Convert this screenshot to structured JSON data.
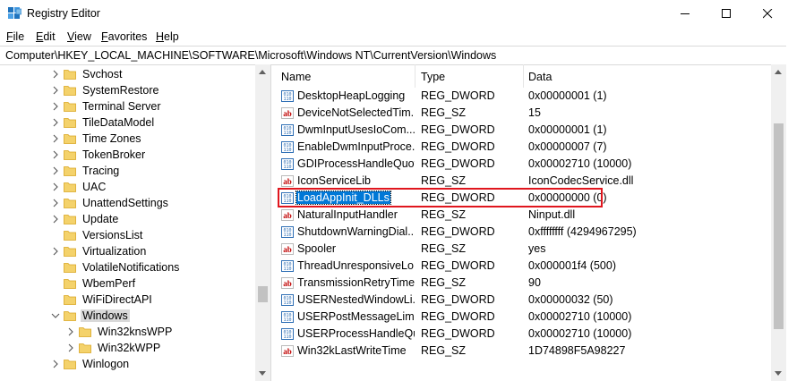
{
  "window": {
    "title": "Registry Editor"
  },
  "menu": [
    "File",
    "Edit",
    "View",
    "Favorites",
    "Help"
  ],
  "address": "Computer\\HKEY_LOCAL_MACHINE\\SOFTWARE\\Microsoft\\Windows NT\\CurrentVersion\\Windows",
  "tree": [
    {
      "label": "Svchost",
      "expandable": true,
      "indent": 1
    },
    {
      "label": "SystemRestore",
      "expandable": true,
      "indent": 1
    },
    {
      "label": "Terminal Server",
      "expandable": true,
      "indent": 1
    },
    {
      "label": "TileDataModel",
      "expandable": true,
      "indent": 1
    },
    {
      "label": "Time Zones",
      "expandable": true,
      "indent": 1
    },
    {
      "label": "TokenBroker",
      "expandable": true,
      "indent": 1
    },
    {
      "label": "Tracing",
      "expandable": true,
      "indent": 1
    },
    {
      "label": "UAC",
      "expandable": true,
      "indent": 1
    },
    {
      "label": "UnattendSettings",
      "expandable": true,
      "indent": 1
    },
    {
      "label": "Update",
      "expandable": true,
      "indent": 1
    },
    {
      "label": "VersionsList",
      "expandable": false,
      "indent": 1
    },
    {
      "label": "Virtualization",
      "expandable": true,
      "indent": 1
    },
    {
      "label": "VolatileNotifications",
      "expandable": false,
      "indent": 1
    },
    {
      "label": "WbemPerf",
      "expandable": false,
      "indent": 1
    },
    {
      "label": "WiFiDirectAPI",
      "expandable": false,
      "indent": 1
    },
    {
      "label": "Windows",
      "expandable": true,
      "expanded": true,
      "selected": true,
      "indent": 1
    },
    {
      "label": "Win32knsWPP",
      "expandable": true,
      "indent": 2
    },
    {
      "label": "Win32kWPP",
      "expandable": true,
      "indent": 2
    },
    {
      "label": "Winlogon",
      "expandable": true,
      "indent": 1
    }
  ],
  "columns": {
    "name": "Name",
    "type": "Type",
    "data": "Data"
  },
  "values": [
    {
      "name": "DesktopHeapLogging",
      "type": "REG_DWORD",
      "data": "0x00000001 (1)",
      "icon": "dword"
    },
    {
      "name": "DeviceNotSelectedTim...",
      "type": "REG_SZ",
      "data": "15",
      "icon": "sz"
    },
    {
      "name": "DwmInputUsesIoCom...",
      "type": "REG_DWORD",
      "data": "0x00000001 (1)",
      "icon": "dword"
    },
    {
      "name": "EnableDwmInputProce...",
      "type": "REG_DWORD",
      "data": "0x00000007 (7)",
      "icon": "dword"
    },
    {
      "name": "GDIProcessHandleQuota",
      "type": "REG_DWORD",
      "data": "0x00002710 (10000)",
      "icon": "dword"
    },
    {
      "name": "IconServiceLib",
      "type": "REG_SZ",
      "data": "IconCodecService.dll",
      "icon": "sz"
    },
    {
      "name": "LoadAppInit_DLLs",
      "type": "REG_DWORD",
      "data": "0x00000000 (0)",
      "icon": "dword",
      "selected": true
    },
    {
      "name": "NaturalInputHandler",
      "type": "REG_SZ",
      "data": "Ninput.dll",
      "icon": "sz"
    },
    {
      "name": "ShutdownWarningDial...",
      "type": "REG_DWORD",
      "data": "0xffffffff (4294967295)",
      "icon": "dword"
    },
    {
      "name": "Spooler",
      "type": "REG_SZ",
      "data": "yes",
      "icon": "sz"
    },
    {
      "name": "ThreadUnresponsiveLo...",
      "type": "REG_DWORD",
      "data": "0x000001f4 (500)",
      "icon": "dword"
    },
    {
      "name": "TransmissionRetryTime...",
      "type": "REG_SZ",
      "data": "90",
      "icon": "sz"
    },
    {
      "name": "USERNestedWindowLi...",
      "type": "REG_DWORD",
      "data": "0x00000032 (50)",
      "icon": "dword"
    },
    {
      "name": "USERPostMessageLimit",
      "type": "REG_DWORD",
      "data": "0x00002710 (10000)",
      "icon": "dword"
    },
    {
      "name": "USERProcessHandleQu...",
      "type": "REG_DWORD",
      "data": "0x00002710 (10000)",
      "icon": "dword"
    },
    {
      "name": "Win32kLastWriteTime",
      "type": "REG_SZ",
      "data": "1D74898F5A98227",
      "icon": "sz"
    }
  ],
  "colors": {
    "accent": "#0078d7",
    "highlight": "#e0161e",
    "folder": "#f4d26b"
  }
}
